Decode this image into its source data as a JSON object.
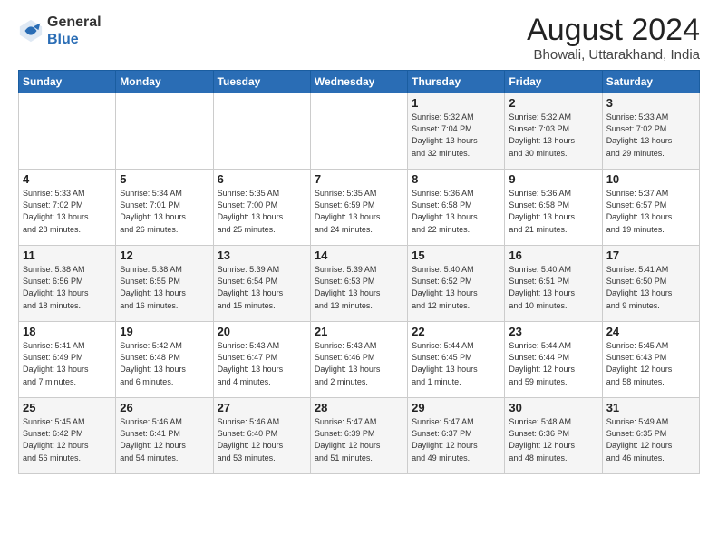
{
  "logo": {
    "general": "General",
    "blue": "Blue"
  },
  "header": {
    "title": "August 2024",
    "subtitle": "Bhowali, Uttarakhand, India"
  },
  "weekdays": [
    "Sunday",
    "Monday",
    "Tuesday",
    "Wednesday",
    "Thursday",
    "Friday",
    "Saturday"
  ],
  "weeks": [
    [
      {
        "day": "",
        "info": ""
      },
      {
        "day": "",
        "info": ""
      },
      {
        "day": "",
        "info": ""
      },
      {
        "day": "",
        "info": ""
      },
      {
        "day": "1",
        "info": "Sunrise: 5:32 AM\nSunset: 7:04 PM\nDaylight: 13 hours\nand 32 minutes."
      },
      {
        "day": "2",
        "info": "Sunrise: 5:32 AM\nSunset: 7:03 PM\nDaylight: 13 hours\nand 30 minutes."
      },
      {
        "day": "3",
        "info": "Sunrise: 5:33 AM\nSunset: 7:02 PM\nDaylight: 13 hours\nand 29 minutes."
      }
    ],
    [
      {
        "day": "4",
        "info": "Sunrise: 5:33 AM\nSunset: 7:02 PM\nDaylight: 13 hours\nand 28 minutes."
      },
      {
        "day": "5",
        "info": "Sunrise: 5:34 AM\nSunset: 7:01 PM\nDaylight: 13 hours\nand 26 minutes."
      },
      {
        "day": "6",
        "info": "Sunrise: 5:35 AM\nSunset: 7:00 PM\nDaylight: 13 hours\nand 25 minutes."
      },
      {
        "day": "7",
        "info": "Sunrise: 5:35 AM\nSunset: 6:59 PM\nDaylight: 13 hours\nand 24 minutes."
      },
      {
        "day": "8",
        "info": "Sunrise: 5:36 AM\nSunset: 6:58 PM\nDaylight: 13 hours\nand 22 minutes."
      },
      {
        "day": "9",
        "info": "Sunrise: 5:36 AM\nSunset: 6:58 PM\nDaylight: 13 hours\nand 21 minutes."
      },
      {
        "day": "10",
        "info": "Sunrise: 5:37 AM\nSunset: 6:57 PM\nDaylight: 13 hours\nand 19 minutes."
      }
    ],
    [
      {
        "day": "11",
        "info": "Sunrise: 5:38 AM\nSunset: 6:56 PM\nDaylight: 13 hours\nand 18 minutes."
      },
      {
        "day": "12",
        "info": "Sunrise: 5:38 AM\nSunset: 6:55 PM\nDaylight: 13 hours\nand 16 minutes."
      },
      {
        "day": "13",
        "info": "Sunrise: 5:39 AM\nSunset: 6:54 PM\nDaylight: 13 hours\nand 15 minutes."
      },
      {
        "day": "14",
        "info": "Sunrise: 5:39 AM\nSunset: 6:53 PM\nDaylight: 13 hours\nand 13 minutes."
      },
      {
        "day": "15",
        "info": "Sunrise: 5:40 AM\nSunset: 6:52 PM\nDaylight: 13 hours\nand 12 minutes."
      },
      {
        "day": "16",
        "info": "Sunrise: 5:40 AM\nSunset: 6:51 PM\nDaylight: 13 hours\nand 10 minutes."
      },
      {
        "day": "17",
        "info": "Sunrise: 5:41 AM\nSunset: 6:50 PM\nDaylight: 13 hours\nand 9 minutes."
      }
    ],
    [
      {
        "day": "18",
        "info": "Sunrise: 5:41 AM\nSunset: 6:49 PM\nDaylight: 13 hours\nand 7 minutes."
      },
      {
        "day": "19",
        "info": "Sunrise: 5:42 AM\nSunset: 6:48 PM\nDaylight: 13 hours\nand 6 minutes."
      },
      {
        "day": "20",
        "info": "Sunrise: 5:43 AM\nSunset: 6:47 PM\nDaylight: 13 hours\nand 4 minutes."
      },
      {
        "day": "21",
        "info": "Sunrise: 5:43 AM\nSunset: 6:46 PM\nDaylight: 13 hours\nand 2 minutes."
      },
      {
        "day": "22",
        "info": "Sunrise: 5:44 AM\nSunset: 6:45 PM\nDaylight: 13 hours\nand 1 minute."
      },
      {
        "day": "23",
        "info": "Sunrise: 5:44 AM\nSunset: 6:44 PM\nDaylight: 12 hours\nand 59 minutes."
      },
      {
        "day": "24",
        "info": "Sunrise: 5:45 AM\nSunset: 6:43 PM\nDaylight: 12 hours\nand 58 minutes."
      }
    ],
    [
      {
        "day": "25",
        "info": "Sunrise: 5:45 AM\nSunset: 6:42 PM\nDaylight: 12 hours\nand 56 minutes."
      },
      {
        "day": "26",
        "info": "Sunrise: 5:46 AM\nSunset: 6:41 PM\nDaylight: 12 hours\nand 54 minutes."
      },
      {
        "day": "27",
        "info": "Sunrise: 5:46 AM\nSunset: 6:40 PM\nDaylight: 12 hours\nand 53 minutes."
      },
      {
        "day": "28",
        "info": "Sunrise: 5:47 AM\nSunset: 6:39 PM\nDaylight: 12 hours\nand 51 minutes."
      },
      {
        "day": "29",
        "info": "Sunrise: 5:47 AM\nSunset: 6:37 PM\nDaylight: 12 hours\nand 49 minutes."
      },
      {
        "day": "30",
        "info": "Sunrise: 5:48 AM\nSunset: 6:36 PM\nDaylight: 12 hours\nand 48 minutes."
      },
      {
        "day": "31",
        "info": "Sunrise: 5:49 AM\nSunset: 6:35 PM\nDaylight: 12 hours\nand 46 minutes."
      }
    ]
  ]
}
